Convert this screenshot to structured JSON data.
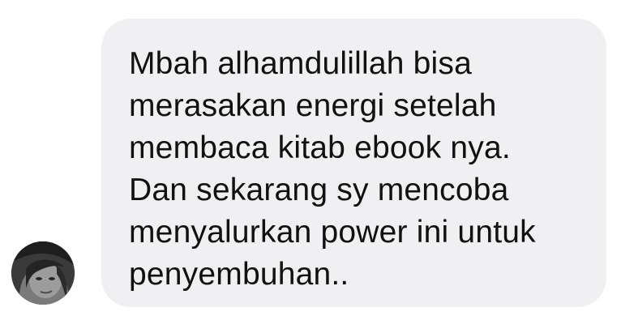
{
  "chat": {
    "message_text": "Mbah alhamdulillah bisa\nmerasakan energi setelah\nmembaca kitab ebook nya.\nDan sekarang sy mencoba\nmenyalurkan power ini untuk\npenyembuhan.."
  },
  "avatar": {
    "icon": "user-avatar-photo",
    "style": "grayscale"
  },
  "colors": {
    "bubble": "#f0f0f2",
    "text": "#111111",
    "background": "#ffffff"
  }
}
